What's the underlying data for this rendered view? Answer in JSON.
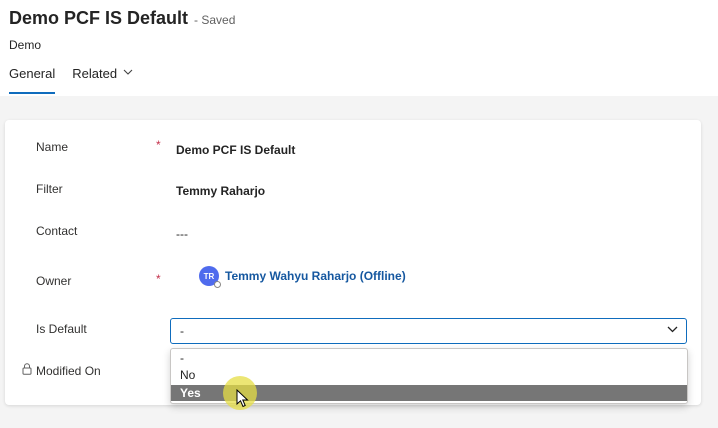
{
  "header": {
    "title": "Demo PCF IS Default",
    "save_status": "- Saved",
    "entity_name": "Demo"
  },
  "tabs": [
    {
      "label": "General"
    },
    {
      "label": "Related"
    }
  ],
  "form": {
    "name": {
      "label": "Name",
      "required": "*",
      "value": "Demo PCF IS Default"
    },
    "filter": {
      "label": "Filter",
      "value": "Temmy Raharjo"
    },
    "contact": {
      "label": "Contact",
      "value": "---"
    },
    "owner": {
      "label": "Owner",
      "required": "*",
      "initials": "TR",
      "value": "Temmy Wahyu Raharjo (Offline)"
    },
    "is_default": {
      "label": "Is Default",
      "value": "-"
    },
    "modified_on": {
      "label": "Modified On"
    }
  },
  "dropdown": {
    "options": [
      "-",
      "No",
      "Yes"
    ],
    "highlighted": "Yes"
  },
  "colors": {
    "accent": "#0f6cbd",
    "link": "#1658a0",
    "required": "#c4314b",
    "avatar": "#4f6bed",
    "highlight": "#767676"
  },
  "icons": [
    "chevron-down-icon",
    "lock-icon",
    "mouse-pointer-icon"
  ]
}
